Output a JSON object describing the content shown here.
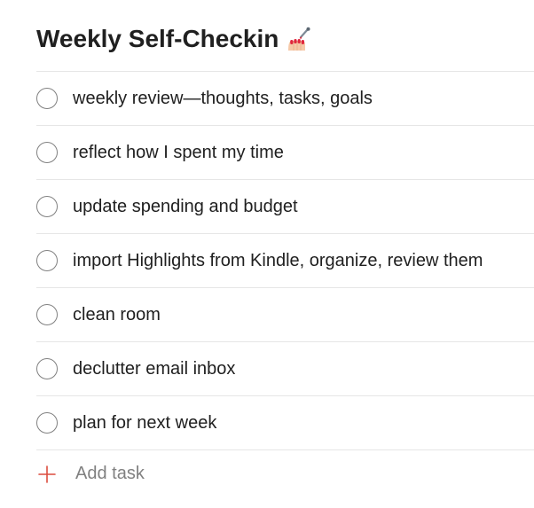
{
  "project": {
    "title": "Weekly Self-Checkin",
    "title_icon": "nail-polish-icon"
  },
  "tasks": [
    {
      "label": "weekly review—thoughts, tasks, goals"
    },
    {
      "label": "reflect how I spent my time"
    },
    {
      "label": "update spending and budget"
    },
    {
      "label": "import Highlights from Kindle, organize, review them"
    },
    {
      "label": "clean room"
    },
    {
      "label": "declutter email inbox"
    },
    {
      "label": "plan for next week"
    }
  ],
  "add_task": {
    "label": "Add task",
    "icon": "plus-icon",
    "accent_color": "#dc4c3e"
  },
  "colors": {
    "text": "#202020",
    "muted": "#808080",
    "divider": "#e6e6e6",
    "checkbox_border": "#808080"
  }
}
